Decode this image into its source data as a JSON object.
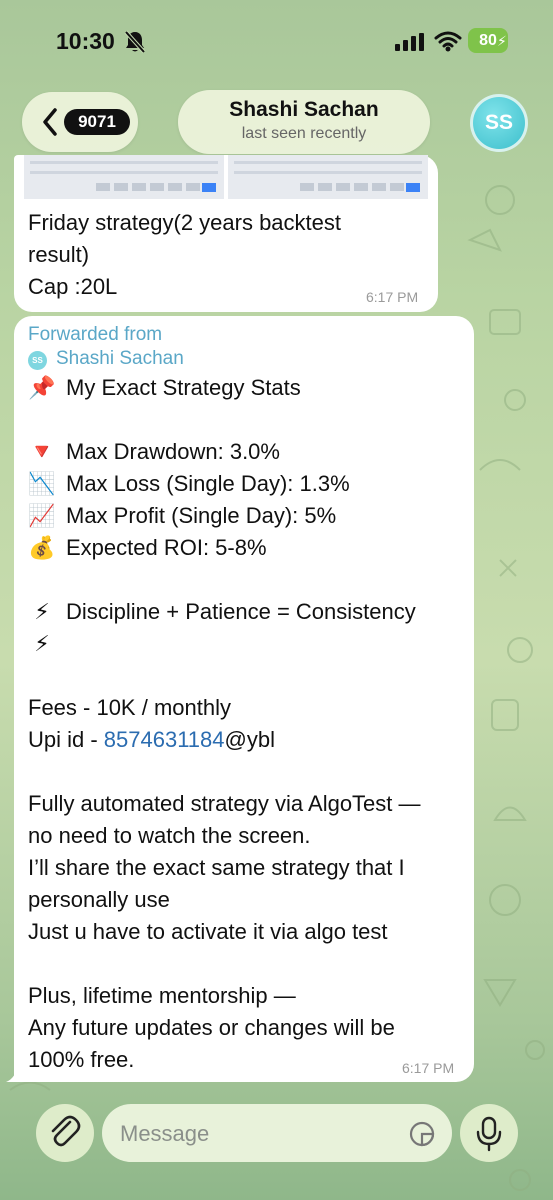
{
  "status_bar": {
    "time": "10:30",
    "battery": "80"
  },
  "header": {
    "back_count": "9071",
    "chat_name": "Shashi Sachan",
    "chat_status": "last seen recently",
    "avatar_initials": "SS"
  },
  "message1": {
    "lines": [
      "Friday strategy(2 years backtest",
      "result)",
      "Cap :20L"
    ],
    "time": "6:17 PM"
  },
  "message2": {
    "forwarded_label": "Forwarded from",
    "forwarded_avatar": "SS",
    "forwarded_name": "Shashi Sachan",
    "title": {
      "emoji": "📌",
      "text": "My Exact Strategy Stats"
    },
    "stats": [
      {
        "emoji": "🔻",
        "text": "Max Drawdown: 3.0%"
      },
      {
        "emoji": "📉",
        "text": "Max Loss (Single Day): 1.3%"
      },
      {
        "emoji": "📈",
        "text": "Max Profit (Single Day): 5%"
      },
      {
        "emoji": "💰",
        "text": "Expected ROI: 5-8%"
      }
    ],
    "motto": {
      "emoji": "⚡",
      "text": "Discipline + Patience = Consistency",
      "emoji_end": "⚡"
    },
    "fees": "Fees - 10K / monthly",
    "upi_prefix": "Upi id - ",
    "upi_number": "8574631184",
    "upi_suffix": "@ybl",
    "body_lines": [
      "Fully automated strategy via AlgoTest —",
      "no need to watch the screen.",
      "I’ll share the exact same strategy that I",
      "personally use",
      "Just u have to activate it via algo test"
    ],
    "closing_lines": [
      "Plus, lifetime mentorship —",
      "Any future updates or changes will be",
      "100% free."
    ],
    "time": "6:17 PM"
  },
  "input": {
    "placeholder": "Message"
  },
  "icons": {
    "back": "chevron-left-icon",
    "attach": "paperclip-icon",
    "sticker": "sticker-icon",
    "mic": "microphone-icon",
    "bell": "bell-slash-icon",
    "signal": "signal-icon",
    "wifi": "wifi-icon"
  },
  "colors": {
    "link": "#2b6cb0",
    "forwarded": "#5aa7c7",
    "battery": "#7fc34a",
    "avatar": "#3dbfcc"
  }
}
